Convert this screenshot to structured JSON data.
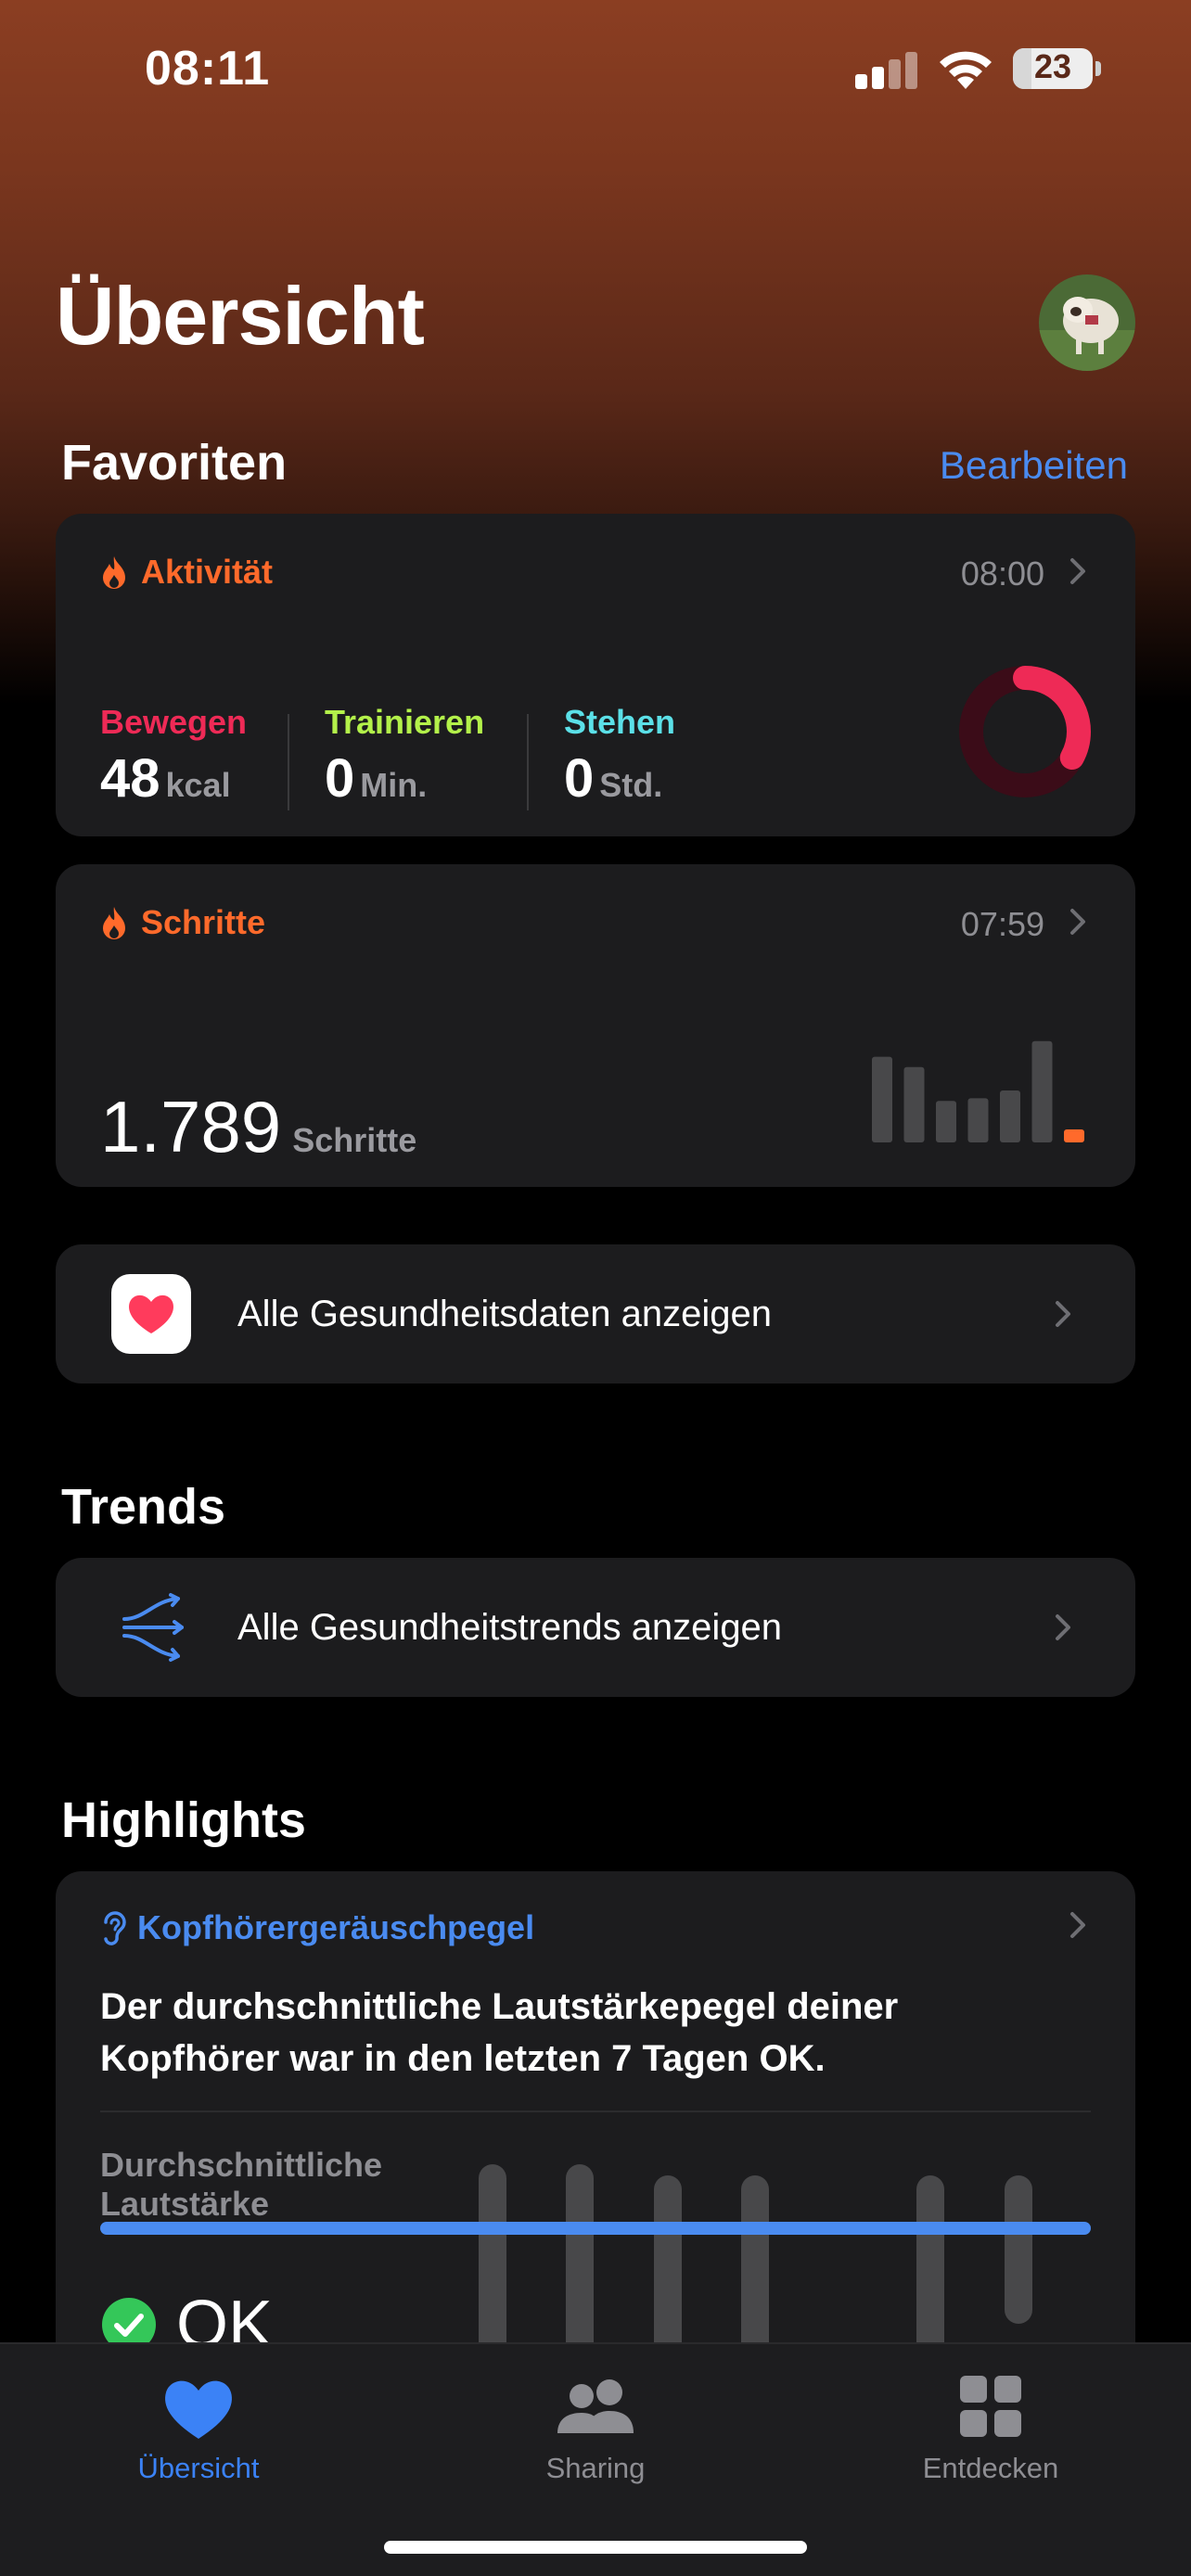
{
  "status": {
    "time": "08:11",
    "battery": "23",
    "battery_level": 0.23
  },
  "header": {
    "title": "Übersicht"
  },
  "favorites": {
    "title": "Favoriten",
    "edit_label": "Bearbeiten"
  },
  "activity": {
    "title": "Aktivität",
    "time": "08:00",
    "move_label": "Bewegen",
    "move_value": "48",
    "move_unit": "kcal",
    "exercise_label": "Trainieren",
    "exercise_value": "0",
    "exercise_unit": "Min.",
    "stand_label": "Stehen",
    "stand_value": "0",
    "stand_unit": "Std.",
    "move_progress": 0.33,
    "colors": {
      "move": "#ee2a56",
      "exercise": "#b3f14a",
      "stand": "#5be0e8",
      "accent": "#ff6a2b"
    }
  },
  "steps": {
    "title": "Schritte",
    "time": "07:59",
    "value": "1.789",
    "unit": "Schritte",
    "bars": [
      0.66,
      0.58,
      0.32,
      0.34,
      0.4,
      0.78,
      0.1
    ]
  },
  "all_data": {
    "label": "Alle Gesundheitsdaten anzeigen"
  },
  "trends": {
    "title": "Trends",
    "label": "Alle Gesundheitstrends anzeigen"
  },
  "highlights": {
    "title": "Highlights",
    "card_title": "Kopfhörergeräuschpegel",
    "text": "Der durchschnittliche Lautstärkepegel deiner Kopfhörer war in den letzten 7 Tagen OK.",
    "label": "Durchschnittliche Lautstärke",
    "status": "OK",
    "bars": [
      1,
      1,
      1,
      1,
      0,
      1,
      1
    ]
  },
  "tabs": [
    {
      "label": "Übersicht",
      "icon": "heart-icon",
      "active": true
    },
    {
      "label": "Sharing",
      "icon": "people-icon",
      "active": false
    },
    {
      "label": "Entdecken",
      "icon": "grid-icon",
      "active": false
    }
  ],
  "colors": {
    "accent_blue": "#4a8bf0",
    "active_tab": "#3b82f6",
    "inactive_tab": "#8e8e93"
  }
}
